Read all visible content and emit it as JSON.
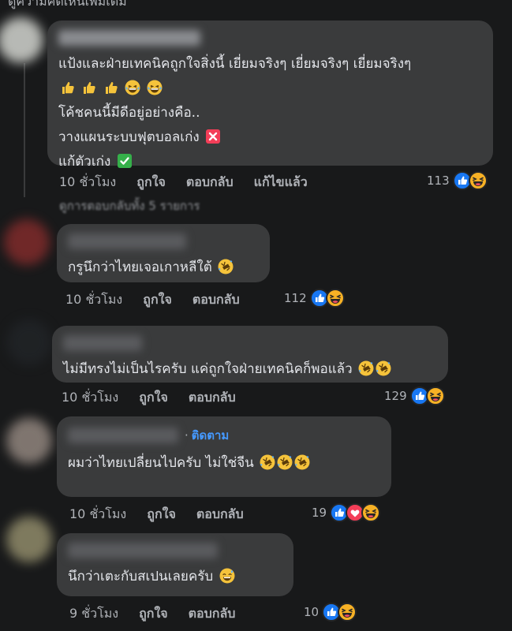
{
  "top_text": "ดูความคิดเห็นเพิ่มเติม",
  "comments": [
    {
      "lines": [
        "แป้งและฝ่ายเทคนิคถูกใจสิ่งนี้ เยี่ยมจริงๆ เยี่ยมจริงๆ เยี่ยมจริงๆ",
        "",
        "โค้ชคนนี้มีดีอยู่อย่างคือ..",
        "วางแผนระบบฟุตบอลเก่ง",
        "แก้ตัวเก่ง"
      ],
      "time": "10 ชั่วโมง",
      "like": "ถูกใจ",
      "reply": "ตอบกลับ",
      "edited": "แก้ไขแล้ว",
      "reaction_count": "113",
      "reactions": [
        "like-icon",
        "haha-icon"
      ]
    },
    {
      "hidden_replies": "ดูการตอบกลับทั้ง 5 รายการ",
      "lines": [
        "กรูนึกว่าไทยเจอเกาหลีใต้"
      ],
      "time": "10 ชั่วโมง",
      "like": "ถูกใจ",
      "reply": "ตอบกลับ",
      "reaction_count": "112",
      "reactions": [
        "like-icon",
        "haha-icon"
      ]
    },
    {
      "lines": [
        "ไม่มีทรงไม่เป็นไรครับ แค่ถูกใจฝ่ายเทคนิคก็พอแล้ว"
      ],
      "time": "10 ชั่วโมง",
      "like": "ถูกใจ",
      "reply": "ตอบกลับ",
      "reaction_count": "129",
      "reactions": [
        "like-icon",
        "haha-icon"
      ]
    },
    {
      "follow_dot": "·",
      "follow": "ติดตาม",
      "lines": [
        "ผมว่าไทยเปลี่ยนไปครับ ไม่ใช่จีน"
      ],
      "time": "10 ชั่วโมง",
      "like": "ถูกใจ",
      "reply": "ตอบกลับ",
      "reaction_count": "19",
      "reactions": [
        "like-icon",
        "love-icon",
        "haha-icon"
      ]
    },
    {
      "lines": [
        "นึกว่าเตะกับสเปนเลยครับ"
      ],
      "time": "9 ชั่วโมง",
      "like": "ถูกใจ",
      "reply": "ตอบกลับ",
      "reaction_count": "10",
      "reactions": [
        "like-icon",
        "haha-icon"
      ]
    }
  ],
  "colors": {
    "background": "#18191a",
    "bubble": "#3a3b3c",
    "text": "#e4e6eb",
    "secondary_text": "#b0b3b8",
    "like_blue": "#1877f2",
    "love_red": "#f33e58",
    "follow_blue": "#4599ff"
  }
}
